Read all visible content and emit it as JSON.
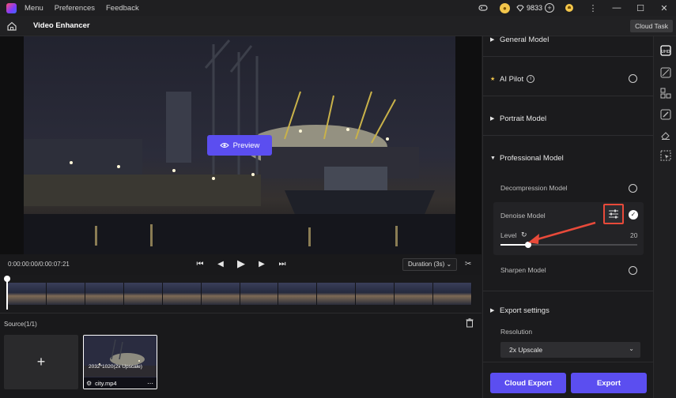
{
  "titlebar": {
    "menu": [
      "Menu",
      "Preferences",
      "Feedback"
    ],
    "credits": "9833"
  },
  "header": {
    "title": "Video Enhancer",
    "cloud_task": "Cloud Task"
  },
  "preview": {
    "button_label": "Preview"
  },
  "controls": {
    "timecode": "0:00:00:00/0:00:07:21",
    "duration_label": "Duration (3s)"
  },
  "source": {
    "title": "Source(1/1)",
    "clip_resolution": "2032*1020(2x Upscale)",
    "clip_name": "city.mp4"
  },
  "panel": {
    "general_model": "General Model",
    "ai_pilot": "AI Pilot",
    "portrait_model": "Portrait Model",
    "professional_model": "Professional Model",
    "decompression_model": "Decompression Model",
    "denoise_model": "Denoise Model",
    "level_label": "Level",
    "level_value": "20",
    "level_fraction": 0.2,
    "sharpen_model": "Sharpen Model",
    "export_settings": "Export settings",
    "resolution_label": "Resolution",
    "resolution_value": "2x Upscale",
    "cloud_export": "Cloud Export",
    "export": "Export"
  },
  "colors": {
    "accent": "#5b4ef0",
    "highlight": "#e84a3a"
  },
  "icons": [
    "home-icon",
    "gem-icon",
    "bell-icon",
    "game-icon",
    "coin-icon",
    "trash-icon",
    "scissors-icon",
    "eye-icon",
    "settings-sliders-icon",
    "refresh-icon",
    "info-icon",
    "star-icon"
  ]
}
